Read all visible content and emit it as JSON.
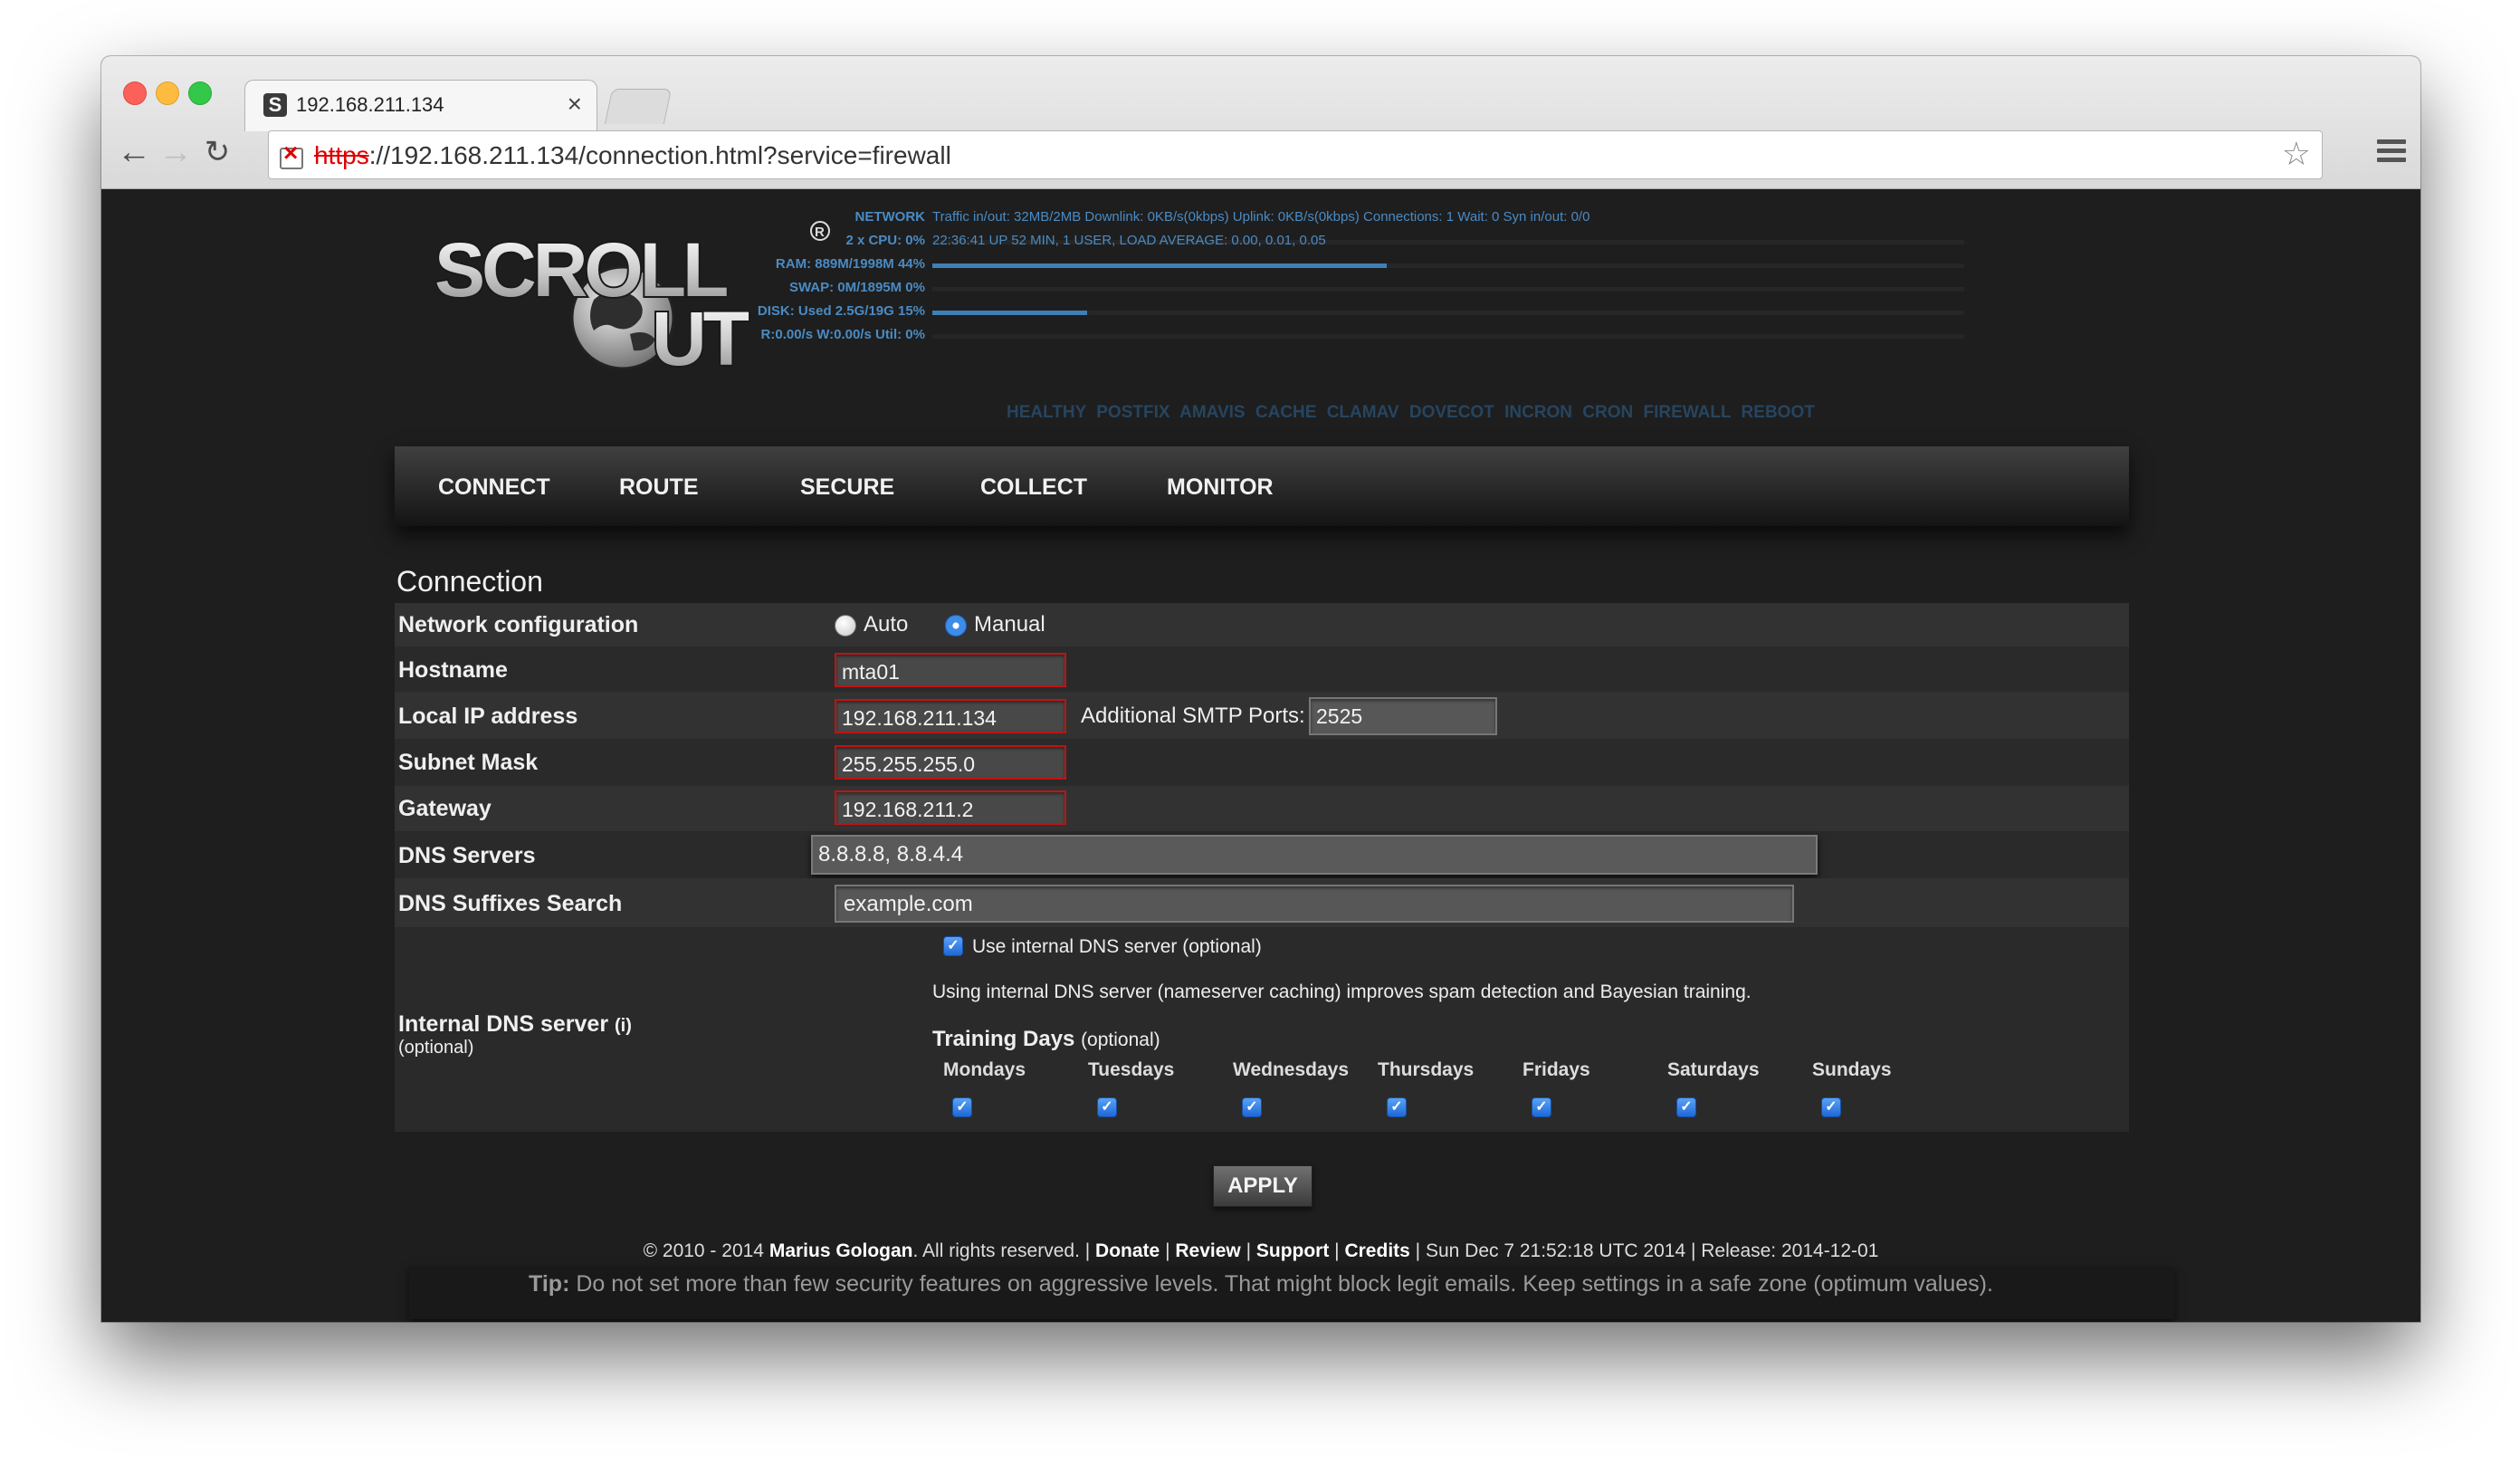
{
  "browser": {
    "tab_title": "192.168.211.134",
    "tab_close": "×",
    "url_scheme": "https",
    "url_rest": "://192.168.211.134/connection.html?service=firewall"
  },
  "logo": {
    "text": "SCROLLOUT"
  },
  "system": {
    "rows": [
      {
        "label": "NETWORK",
        "value": "Traffic in/out: 32MB/2MB  Downlink: 0KB/s(0kbps)  Uplink: 0KB/s(0kbps)  Connections: 1  Wait: 0  Syn in/out: 0/0"
      },
      {
        "label": "2 x CPU: 0%",
        "value": "22:36:41 UP 52 MIN, 1 USER, LOAD AVERAGE: 0.00, 0.01, 0.05",
        "fill": 0.0
      },
      {
        "label": "RAM: 889M/1998M 44%",
        "value": "",
        "fill": 0.44
      },
      {
        "label": "SWAP: 0M/1895M 0%",
        "value": "",
        "fill": 0.0
      },
      {
        "label": "DISK: Used 2.5G/19G 15%",
        "value": "",
        "fill": 0.15
      },
      {
        "label": "R:0.00/s W:0.00/s Util: 0%",
        "value": "",
        "fill": 0.0
      }
    ],
    "services": "HEALTHY  POSTFIX AMAVIS CACHE CLAMAV DOVECOT INCRON CRON FIREWALL REBOOT"
  },
  "nav": {
    "connect": "CONNECT",
    "route": "ROUTE",
    "secure": "SECURE",
    "collect": "COLLECT",
    "monitor": "MONITOR"
  },
  "section_title": "Connection",
  "form": {
    "network_config": {
      "label": "Network configuration",
      "auto": "Auto",
      "manual": "Manual",
      "selected": "Manual"
    },
    "hostname": {
      "label": "Hostname",
      "value": "mta01"
    },
    "local_ip": {
      "label": "Local IP address",
      "value": "192.168.211.134",
      "smtp_label": "Additional SMTP Ports:",
      "smtp_value": "2525"
    },
    "subnet": {
      "label": "Subnet Mask",
      "value": "255.255.255.0"
    },
    "gateway": {
      "label": "Gateway",
      "value": "192.168.211.2"
    },
    "dns_servers": {
      "label": "DNS Servers",
      "value": "8.8.8.8, 8.8.4.4"
    },
    "dns_suffix": {
      "label": "DNS Suffixes Search",
      "value": "example.com"
    },
    "internal_dns": {
      "label": "Internal DNS server",
      "info": "(i)",
      "optional": "(optional)",
      "checkbox_label": "Use internal DNS server (optional)",
      "checked": true,
      "note": "Using internal DNS server (nameserver caching) improves spam detection and Bayesian training.",
      "training_title": "Training Days",
      "training_optional": "(optional)",
      "days": [
        "Mondays",
        "Tuesdays",
        "Wednesdays",
        "Thursdays",
        "Fridays",
        "Saturdays",
        "Sundays"
      ],
      "days_checked": [
        true,
        true,
        true,
        true,
        true,
        true,
        true
      ]
    }
  },
  "apply_label": "APPLY",
  "footer": {
    "copyright": "© 2010 - 2014 ",
    "author": "Marius Gologan",
    "rights": ". All rights reserved. | ",
    "donate": "Donate",
    "sep1": " | ",
    "review": "Review",
    "sep2": " | ",
    "support": "Support",
    "sep3": " | ",
    "credits": "Credits",
    "rest": " | Sun Dec 7 21:52:18 UTC 2014 | Release: 2014-12-01"
  },
  "tip": {
    "label": "Tip:",
    "text": " Do not set more than few security features on aggressive levels. That might block legit emails. Keep settings in a safe zone (optimum values)."
  }
}
